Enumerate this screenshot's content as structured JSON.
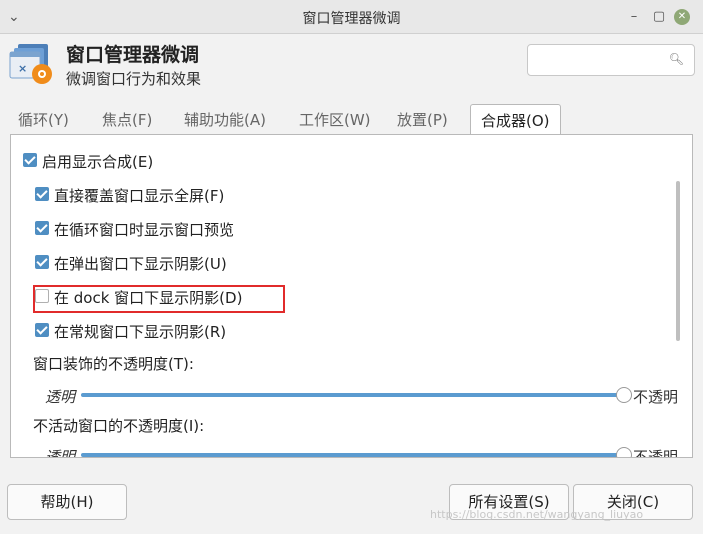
{
  "window": {
    "title": "窗口管理器微调",
    "menu_icon": "chevron-down-icon",
    "controls": {
      "minimize": "minimize-icon",
      "maximize": "maximize-icon",
      "close": "close-icon"
    }
  },
  "header": {
    "title": "窗口管理器微调",
    "subtitle": "微调窗口行为和效果",
    "app_icon": "window-manager-tweaks-icon",
    "search": {
      "placeholder": "",
      "value": ""
    }
  },
  "tabs": [
    {
      "label": "循环(Y)",
      "active": false
    },
    {
      "label": "焦点(F)",
      "active": false
    },
    {
      "label": "辅助功能(A)",
      "active": false
    },
    {
      "label": "工作区(W)",
      "active": false
    },
    {
      "label": "放置(P)",
      "active": false
    },
    {
      "label": "合成器(O)",
      "active": true
    }
  ],
  "compositor": {
    "enable": {
      "label": "启用显示合成(E)",
      "checked": true
    },
    "options": [
      {
        "label": "直接覆盖窗口显示全屏(F)",
        "checked": true
      },
      {
        "label": "在循环窗口时显示窗口预览",
        "checked": true
      },
      {
        "label": "在弹出窗口下显示阴影(U)",
        "checked": true
      },
      {
        "label": "在 dock 窗口下显示阴影(D)",
        "checked": false
      },
      {
        "label": "在常规窗口下显示阴影(R)",
        "checked": true
      }
    ],
    "decor_opacity": {
      "label": "窗口装饰的不透明度(T):",
      "min_label": "透明",
      "max_label": "不透明",
      "value": 1.0
    },
    "inactive_opacity": {
      "label": "不活动窗口的不透明度(I):",
      "min_label": "透明",
      "max_label": "不透明",
      "value": 1.0
    }
  },
  "footer": {
    "help": "帮助(H)",
    "all_settings": "所有设置(S)",
    "close": "关闭(C)"
  },
  "watermark": "https://blog.csdn.net/wangyang_liuyao",
  "colors": {
    "accent": "#4f8ec2",
    "highlight_box": "#e12b2b"
  }
}
